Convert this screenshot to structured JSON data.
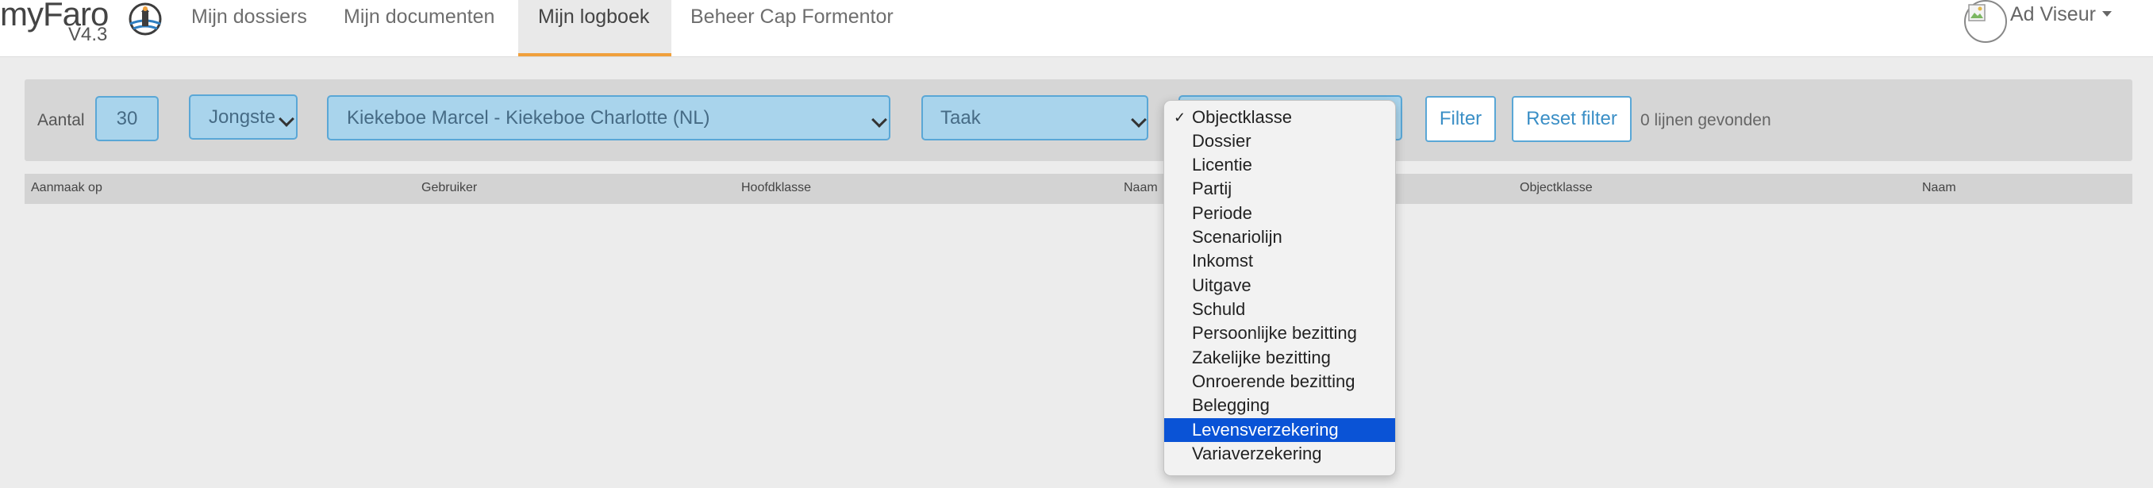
{
  "brand": {
    "name": "myFaro",
    "version": "V4.3",
    "logo_icon": "lighthouse-icon"
  },
  "nav": {
    "links": [
      {
        "label": "Mijn dossiers",
        "active": false
      },
      {
        "label": "Mijn documenten",
        "active": false
      },
      {
        "label": "Mijn logboek",
        "active": true
      },
      {
        "label": "Beheer Cap Formentor",
        "active": false
      }
    ],
    "active_underline_color": "#f0a03c"
  },
  "user": {
    "name": "Ad Viseur",
    "avatar_icon": "broken-image-icon"
  },
  "filters": {
    "count_label": "Aantal",
    "count_value": "30",
    "sort_value": "Jongste",
    "dossier_value": "Kiekeboe Marcel - Kiekeboe Charlotte (NL)",
    "class_value": "Taak",
    "filter_button": "Filter",
    "reset_button": "Reset filter",
    "result_text": "0 lijnen gevonden",
    "accent_color": "#5aa7d6"
  },
  "table": {
    "columns": [
      "Aanmaak op",
      "Gebruiker",
      "Hoofdklasse",
      "Naam",
      "Objectklasse",
      "Naam"
    ],
    "rows": []
  },
  "objectklasse_dropdown": {
    "selected": "Objectklasse",
    "highlighted": "Levensverzekering",
    "highlight_color": "#0a53d6",
    "options": [
      "Objectklasse",
      "Dossier",
      "Licentie",
      "Partij",
      "Periode",
      "Scenariolijn",
      "Inkomst",
      "Uitgave",
      "Schuld",
      "Persoonlijke bezitting",
      "Zakelijke bezitting",
      "Onroerende bezitting",
      "Belegging",
      "Levensverzekering",
      "Variaverzekering"
    ]
  }
}
